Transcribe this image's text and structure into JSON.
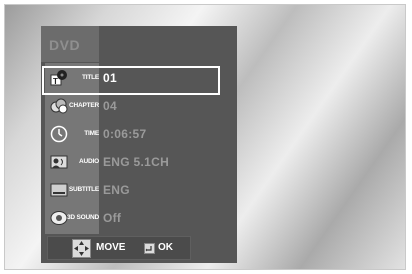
{
  "osd": {
    "header": "DVD",
    "rows": [
      {
        "label": "TITLE",
        "value": "01",
        "icon": "title-icon",
        "selected": true
      },
      {
        "label": "CHAPTER",
        "value": "04",
        "icon": "chapter-icon",
        "selected": false
      },
      {
        "label": "TIME",
        "value": "0:06:57",
        "icon": "time-icon",
        "selected": false
      },
      {
        "label": "AUDIO",
        "value": "ENG 5.1CH",
        "icon": "audio-icon",
        "selected": false
      },
      {
        "label": "SUBTITLE",
        "value": "ENG",
        "icon": "subtitle-icon",
        "selected": false
      },
      {
        "label": "3D SOUND",
        "value": "Off",
        "icon": "3d-sound-icon",
        "selected": false
      }
    ],
    "footer": {
      "move_label": "MOVE",
      "ok_label": "OK",
      "move_icon": "directional-pad-icon",
      "ok_icon": "enter-button-icon"
    }
  },
  "colors": {
    "panel": "#565656",
    "icon_column": "#777777",
    "value_inactive": "#9a9a9a",
    "value_active": "#ffffff",
    "selection_border": "#ffffff"
  }
}
